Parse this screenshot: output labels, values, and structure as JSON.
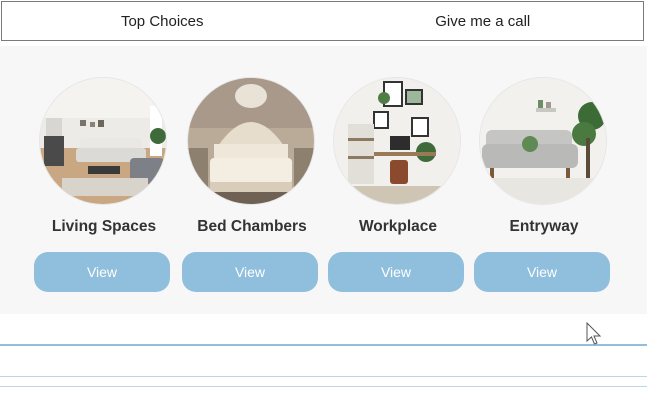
{
  "tabs": [
    {
      "label": "Top Choices"
    },
    {
      "label": "Give me a call"
    }
  ],
  "categories": [
    {
      "title": "Living Spaces",
      "button": "View"
    },
    {
      "title": "Bed Chambers",
      "button": "View"
    },
    {
      "title": "Workplace",
      "button": "View"
    },
    {
      "title": "Entryway",
      "button": "View"
    }
  ],
  "colors": {
    "button": "#8fbfdc",
    "panel": "#f7f7f7",
    "divider": "#8fbfdc"
  }
}
